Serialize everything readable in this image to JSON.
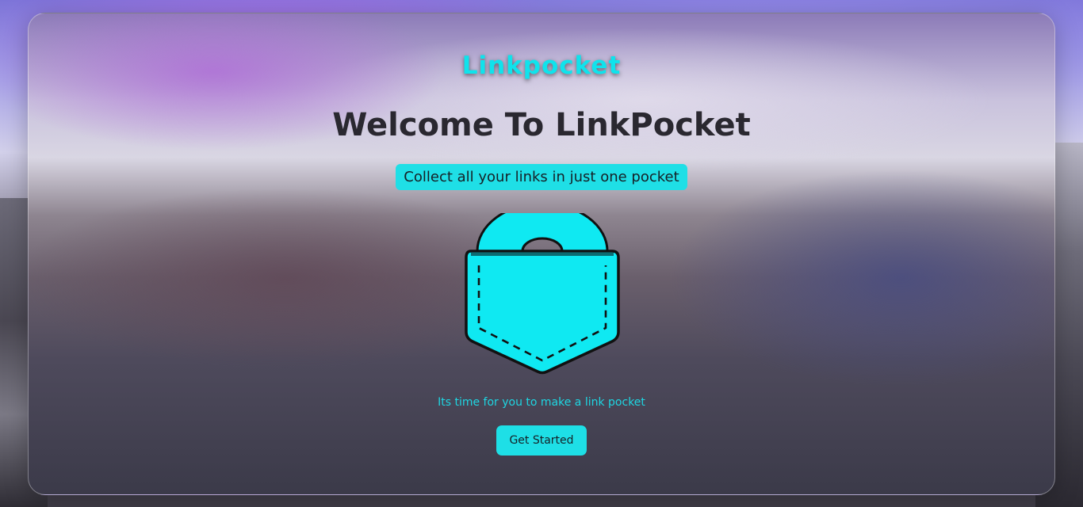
{
  "header": {
    "logo_text": "Linkpocket"
  },
  "main": {
    "title": "Welcome To LinkPocket",
    "tagline": "Collect all your links in just one pocket",
    "illustration": "pocket-icon",
    "subtext": "Its time for you to make a link pocket",
    "cta_label": "Get Started"
  },
  "colors": {
    "accent": "#1fdfe6",
    "title": "#2a2830",
    "outline": "#111111"
  }
}
